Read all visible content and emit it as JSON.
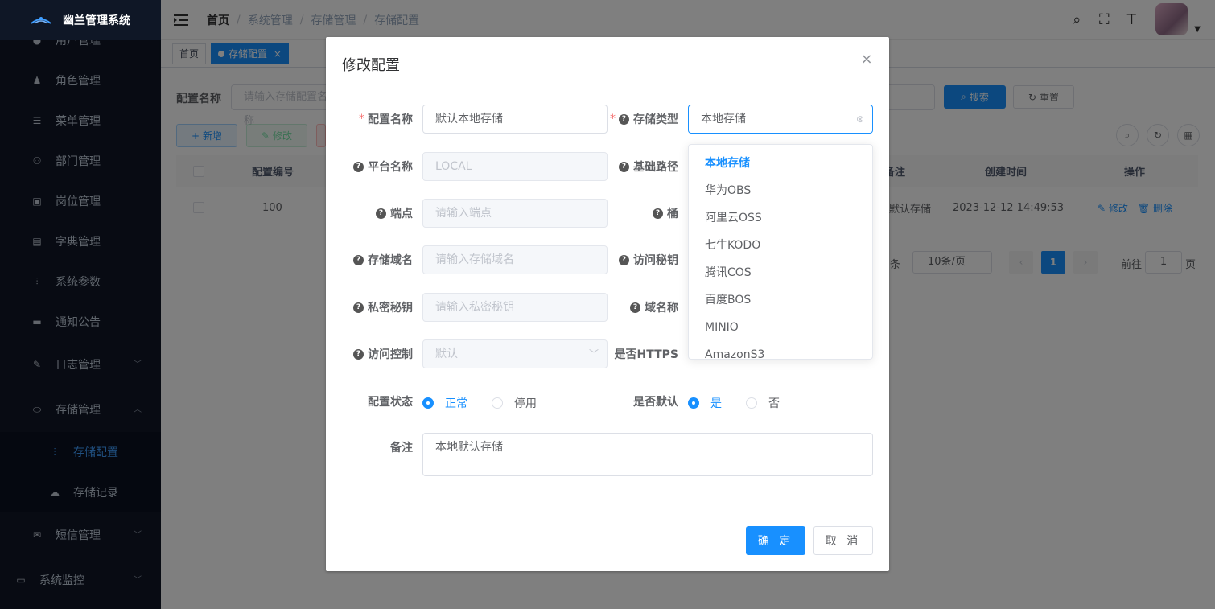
{
  "sidebar": {
    "app_title": "幽兰管理系统",
    "items": [
      {
        "label": "用户管理",
        "icon": "user-icon"
      },
      {
        "label": "角色管理",
        "icon": "peoples-icon"
      },
      {
        "label": "菜单管理",
        "icon": "tree-table-icon"
      },
      {
        "label": "部门管理",
        "icon": "tree-icon"
      },
      {
        "label": "岗位管理",
        "icon": "post-icon"
      },
      {
        "label": "字典管理",
        "icon": "dict-icon"
      },
      {
        "label": "系统参数",
        "icon": "edit-icon"
      },
      {
        "label": "通知公告",
        "icon": "message-icon"
      },
      {
        "label": "日志管理",
        "icon": "log-icon"
      },
      {
        "label": "存储管理",
        "icon": "storage-icon"
      },
      {
        "label": "存储配置",
        "icon": "config-icon"
      },
      {
        "label": "存储记录",
        "icon": "upload-icon"
      },
      {
        "label": "短信管理",
        "icon": "sms-icon"
      },
      {
        "label": "系统监控",
        "icon": "monitor-icon"
      }
    ]
  },
  "breadcrumb": [
    "首页",
    "系统管理",
    "存储管理",
    "存储配置"
  ],
  "tags": [
    "首页",
    "存储配置"
  ],
  "query": {
    "label": "配置名称",
    "placeholder": "请输入存储配置名称",
    "search": "搜索",
    "reset": "重置"
  },
  "toolbar": {
    "add": "新增",
    "edit": "修改"
  },
  "table": {
    "headers": [
      "配置编号",
      "备注",
      "创建时间",
      "操作"
    ],
    "row": {
      "id": "100",
      "remark": "本地默认存储",
      "created": "2023-12-12 14:49:53",
      "edit": "修改",
      "delete": "删除"
    }
  },
  "pagination": {
    "total_suffix": "条",
    "page_size": "10条/页",
    "current": "1",
    "goto_prefix": "前往",
    "goto_value": "1",
    "goto_suffix": "页"
  },
  "dialog": {
    "title": "修改配置",
    "fields": {
      "config_name": {
        "label": "配置名称",
        "value": "默认本地存储"
      },
      "storage_type": {
        "label": "存储类型",
        "value": "本地存储"
      },
      "platform_name": {
        "label": "平台名称",
        "value": "LOCAL"
      },
      "base_path": {
        "label": "基础路径"
      },
      "endpoint": {
        "label": "端点",
        "placeholder": "请输入端点"
      },
      "bucket": {
        "label": "桶"
      },
      "domain": {
        "label": "存储域名",
        "placeholder": "请输入存储域名"
      },
      "access_key": {
        "label": "访问秘钥"
      },
      "secret_key": {
        "label": "私密秘钥",
        "placeholder": "请输入私密秘钥"
      },
      "domain_name": {
        "label": "域名称"
      },
      "access_control": {
        "label": "访问控制",
        "value": "默认"
      },
      "is_https": {
        "label": "是否HTTPS"
      },
      "status": {
        "label": "配置状态",
        "options": [
          "正常",
          "停用"
        ],
        "selected": "正常"
      },
      "is_default": {
        "label": "是否默认",
        "options": [
          "是",
          "否"
        ],
        "selected": "是"
      },
      "remark": {
        "label": "备注",
        "value": "本地默认存储"
      }
    },
    "confirm": "确 定",
    "cancel": "取 消"
  },
  "storage_type_options": [
    "本地存储",
    "华为OBS",
    "阿里云OSS",
    "七牛KODO",
    "腾讯COS",
    "百度BOS",
    "MINIO",
    "AmazonS3"
  ],
  "colors": {
    "primary": "#1890ff",
    "sidebar_bg": "#101726",
    "danger": "#f56c6c"
  }
}
